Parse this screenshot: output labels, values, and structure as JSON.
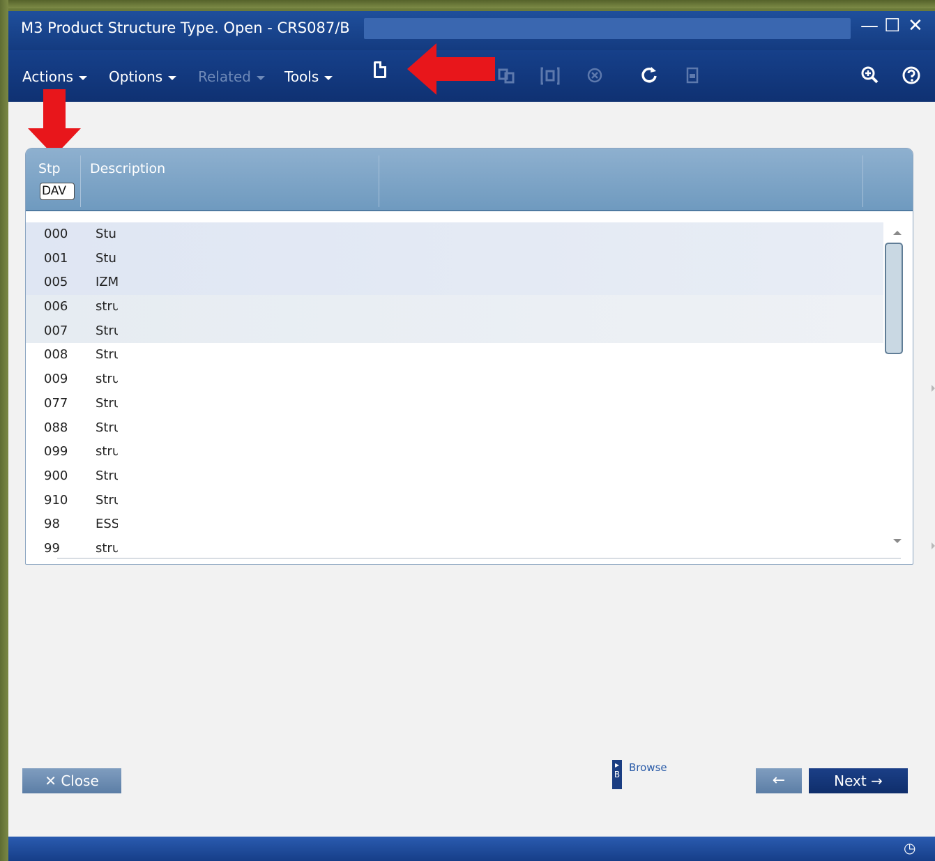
{
  "window": {
    "title": "M3 Product Structure Type. Open - CRS087/B",
    "minimize_glyph": "—",
    "maximize_glyph": "☐",
    "close_glyph": "✕"
  },
  "menu": {
    "actions": "Actions",
    "options": "Options",
    "related": "Related",
    "tools": "Tools"
  },
  "toolbar": {
    "icons": [
      "new-document-icon",
      "copy-icon",
      "change-icon",
      "delete-icon",
      "refresh-icon",
      "display-icon",
      "zoom-icon",
      "help-icon"
    ]
  },
  "list": {
    "columns": [
      "Stp",
      "Description"
    ],
    "filter_value": "DAV",
    "rows": [
      {
        "stp": "000",
        "desc": "Stu"
      },
      {
        "stp": "001",
        "desc": "Stu"
      },
      {
        "stp": "005",
        "desc": "IZM"
      },
      {
        "stp": "006",
        "desc": "stru"
      },
      {
        "stp": "007",
        "desc": "Stru"
      },
      {
        "stp": "008",
        "desc": "Stru"
      },
      {
        "stp": "009",
        "desc": "stru"
      },
      {
        "stp": "077",
        "desc": "Stru"
      },
      {
        "stp": "088",
        "desc": "Stru"
      },
      {
        "stp": "099",
        "desc": "stru"
      },
      {
        "stp": "900",
        "desc": "Stru"
      },
      {
        "stp": "910",
        "desc": "Stru"
      },
      {
        "stp": "98",
        "desc": "ESS"
      },
      {
        "stp": "99",
        "desc": "stru"
      }
    ]
  },
  "footer": {
    "close": "Close",
    "browse": "Browse",
    "browse_key": "B",
    "next": "Next"
  },
  "colors": {
    "titlebar": "#1f4f9c",
    "menubar": "#12387c",
    "header": "#7ea3c6",
    "annotation_arrow": "#e8161b"
  }
}
